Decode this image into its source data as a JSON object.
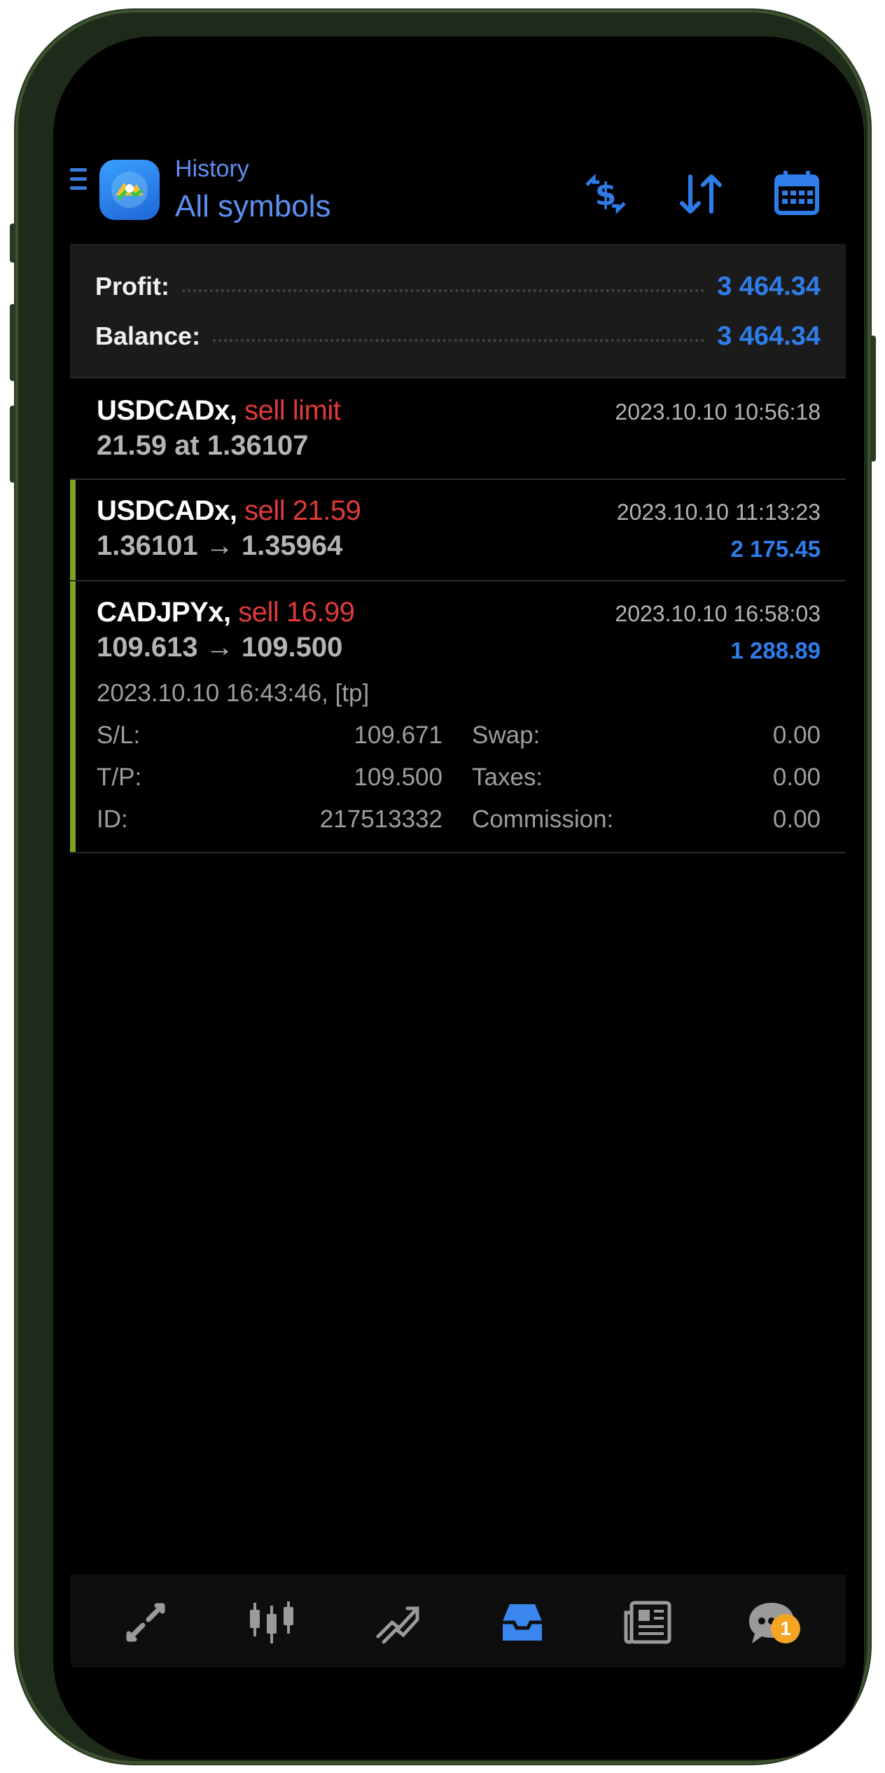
{
  "header": {
    "subtitle": "History",
    "title": "All symbols"
  },
  "summary": {
    "profit_label": "Profit:",
    "profit_value": "3 464.34",
    "balance_label": "Balance:",
    "balance_value": "3 464.34"
  },
  "deals": [
    {
      "symbol": "USDCADx,",
      "action": "sell limit",
      "line2": "21.59 at 1.36107",
      "time": "2023.10.10 10:56:18",
      "profit": ""
    },
    {
      "symbol": "USDCADx,",
      "action": "sell 21.59",
      "line2": "1.36101 → 1.35964",
      "time": "2023.10.10 11:13:23",
      "profit": "2 175.45"
    },
    {
      "symbol": "CADJPYx,",
      "action": "sell 16.99",
      "line2": "109.613 → 109.500",
      "time": "2023.10.10 16:58:03",
      "profit": "1 288.89",
      "details": {
        "open_info": "2023.10.10 16:43:46, [tp]",
        "sl_label": "S/L:",
        "sl_value": "109.671",
        "tp_label": "T/P:",
        "tp_value": "109.500",
        "id_label": "ID:",
        "id_value": "217513332",
        "swap_label": "Swap:",
        "swap_value": "0.00",
        "taxes_label": "Taxes:",
        "taxes_value": "0.00",
        "commission_label": "Commission:",
        "commission_value": "0.00"
      }
    }
  ],
  "nav": {
    "badge_count": "1",
    "items": [
      "quotes-icon",
      "chart-icon",
      "trade-icon",
      "history-icon",
      "news-icon",
      "chat-icon"
    ]
  },
  "colors": {
    "accent": "#2f7dea",
    "sell": "#e03a3a",
    "marker": "#7ba51f",
    "badge": "#f5a523"
  }
}
